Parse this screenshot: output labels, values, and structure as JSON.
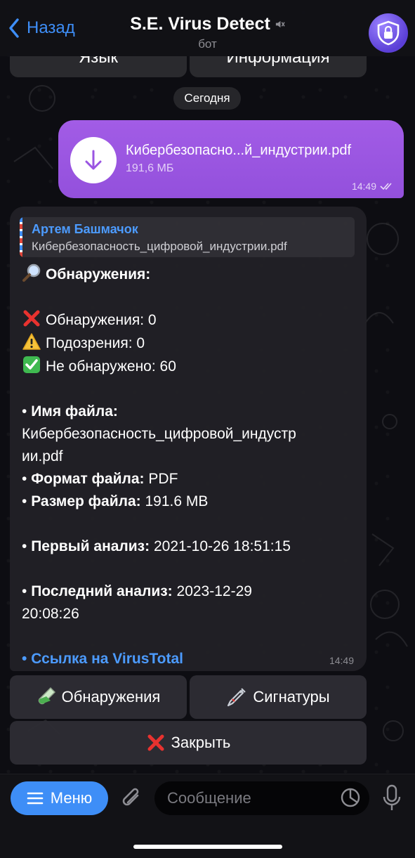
{
  "header": {
    "back_label": "Назад",
    "title": "S.E. Virus Detect",
    "subtitle": "бот"
  },
  "top_keyboard": {
    "left_label": "Язык",
    "right_label": "Информация"
  },
  "date_separator": "Сегодня",
  "outgoing_file": {
    "name": "Кибербезопасно...й_индустрии.pdf",
    "size": "191,6 МБ",
    "time": "14:49"
  },
  "bot_reply": {
    "reply_author": "Артем Башмачок",
    "reply_text": "Кибербезопасность_цифровой_индустрии.pdf",
    "heading": "Обнаружения:",
    "detected": "Обнаружения: 0",
    "suspicious": "Подозрения: 0",
    "undetected": "Не обнаружено: 60",
    "bullet": "•",
    "file_name_label": "Имя файла:",
    "file_name_line1": "Кибербезопасность_цифровой_индустр",
    "file_name_line2": "ии.pdf",
    "format_label": "Формат файла:",
    "format_value": "PDF",
    "size_label": "Размер файла:",
    "size_value": "191.6 MB",
    "first_label": "Первый анализ:",
    "first_value": "2021-10-26 18:51:15",
    "last_label": "Последний анализ:",
    "last_value_line1": "2023-12-29",
    "last_value_line2": "20:08:26",
    "link_label": "Ссылка на VirusTotal",
    "time": "14:49"
  },
  "inline_keyboard": {
    "detections_label": "Обнаружения",
    "signatures_label": "Сигнатуры",
    "close_label": "Закрыть"
  },
  "bottom_bar": {
    "menu_label": "Меню",
    "input_placeholder": "Сообщение"
  },
  "colors": {
    "accent": "#3e8ef7",
    "outgoing_bubble": "#9a55e2",
    "incoming_bubble": "#222126"
  }
}
